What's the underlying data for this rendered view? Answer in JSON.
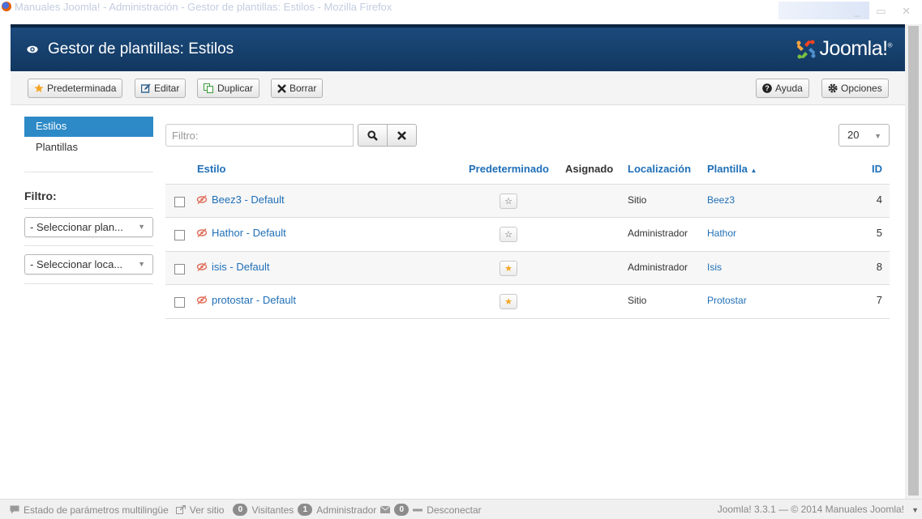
{
  "window": {
    "title": "Manuales Joomla! - Administración - Gestor de plantillas: Estilos - Mozilla Firefox",
    "controls": "_ ▭ ✕"
  },
  "header": {
    "title": "Gestor de plantillas: Estilos",
    "logo_text": "Joomla!",
    "logo_mark": "®"
  },
  "toolbar": {
    "default_label": "Predeterminada",
    "edit_label": "Editar",
    "duplicate_label": "Duplicar",
    "delete_label": "Borrar",
    "help_label": "Ayuda",
    "options_label": "Opciones"
  },
  "sidebar": {
    "items": [
      {
        "label": "Estilos",
        "active": true
      },
      {
        "label": "Plantillas",
        "active": false
      }
    ],
    "filter_label": "Filtro:",
    "template_select": "- Seleccionar plan...",
    "location_select": "- Seleccionar loca..."
  },
  "search": {
    "placeholder": "Filtro:",
    "value": ""
  },
  "list_limit": "20",
  "table": {
    "headers": {
      "style": "Estilo",
      "default": "Predeterminado",
      "assigned": "Asignado",
      "location": "Localización",
      "template": "Plantilla",
      "sort_arrow": "▲",
      "id": "ID"
    },
    "rows": [
      {
        "name": "Beez3 - Default",
        "default": false,
        "location": "Sitio",
        "template": "Beez3",
        "id": "4"
      },
      {
        "name": "Hathor - Default",
        "default": false,
        "location": "Administrador",
        "template": "Hathor",
        "id": "5"
      },
      {
        "name": "isis - Default",
        "default": true,
        "location": "Administrador",
        "template": "Isis",
        "id": "8"
      },
      {
        "name": "protostar - Default",
        "default": true,
        "location": "Sitio",
        "template": "Protostar",
        "id": "7"
      }
    ]
  },
  "footer": {
    "multilang": "Estado de parámetros multilingüe",
    "view_site": "Ver sitio",
    "visitors_count": "0",
    "visitors": "Visitantes",
    "admins_count": "1",
    "admins": "Administrador",
    "messages_count": "0",
    "logout": "Desconectar",
    "version": "Joomla! 3.3.1 — © 2014 Manuales Joomla!"
  },
  "colors": {
    "header_bg": "#1b4a7c",
    "accent": "#2d8ac7",
    "link": "#1f6fb7",
    "star": "#f5a623"
  }
}
